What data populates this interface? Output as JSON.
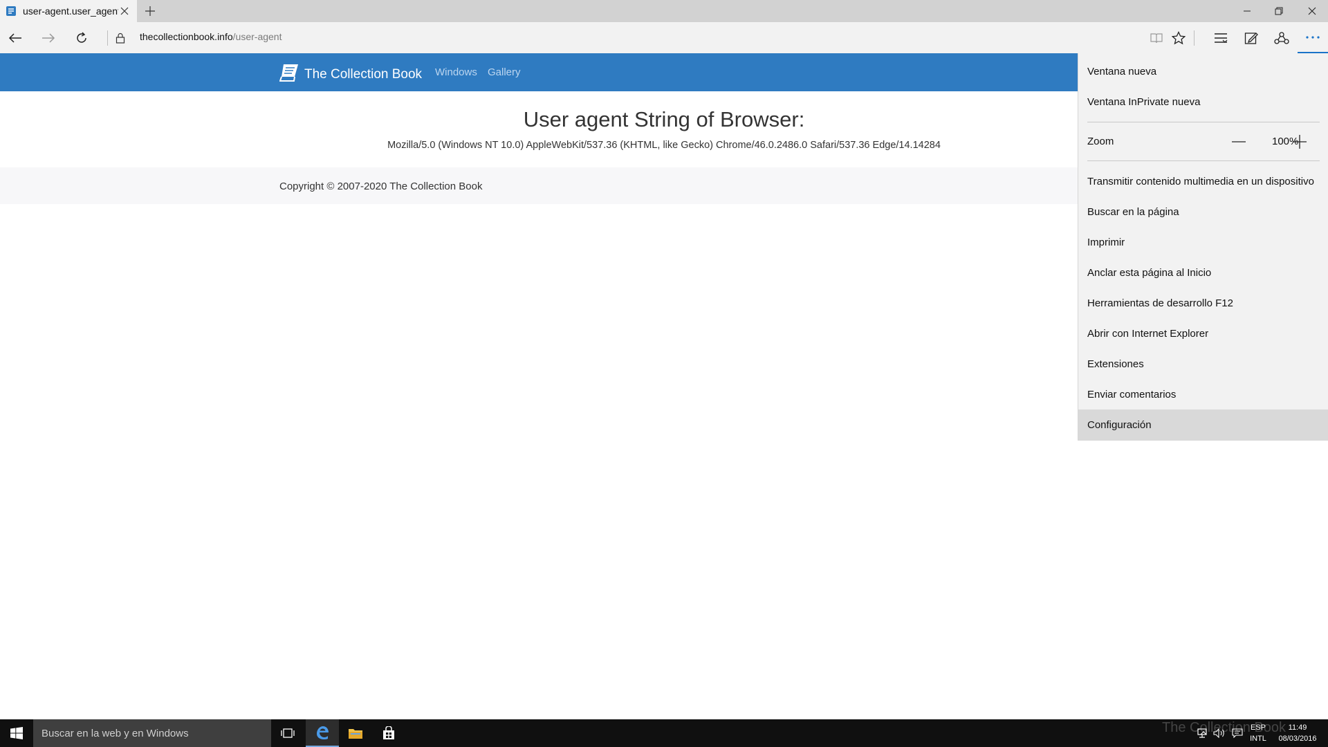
{
  "browser": {
    "tab_title": "user-agent.user_agent -",
    "url_host": "thecollectionbook.info",
    "url_path": "/user-agent",
    "accent": "#1a73c8"
  },
  "site": {
    "brand": "The Collection Book",
    "nav": [
      "Windows",
      "Gallery"
    ],
    "header_color": "#2f7bc1",
    "heading": "User agent String of Browser:",
    "user_agent": "Mozilla/5.0 (Windows NT 10.0) AppleWebKit/537.36 (KHTML, like Gecko) Chrome/46.0.2486.0 Safari/537.36 Edge/14.14284",
    "copyright": "Copyright © 2007-2020 The Collection Book"
  },
  "menu": {
    "new_window": "Ventana nueva",
    "new_inprivate": "Ventana InPrivate nueva",
    "zoom_label": "Zoom",
    "zoom_value": "100%",
    "cast": "Transmitir contenido multimedia en un dispositivo",
    "find": "Buscar en la página",
    "print": "Imprimir",
    "pin": "Anclar esta página al Inicio",
    "devtools": "Herramientas de desarrollo F12",
    "open_ie": "Abrir con Internet Explorer",
    "extensions": "Extensiones",
    "feedback": "Enviar comentarios",
    "settings": "Configuración"
  },
  "taskbar": {
    "search_placeholder": "Buscar en la web y en Windows",
    "lang_top": "ESP",
    "lang_bottom": "INTL",
    "time": "11:49",
    "date": "08/03/2016",
    "watermark": "The Collection Book"
  }
}
